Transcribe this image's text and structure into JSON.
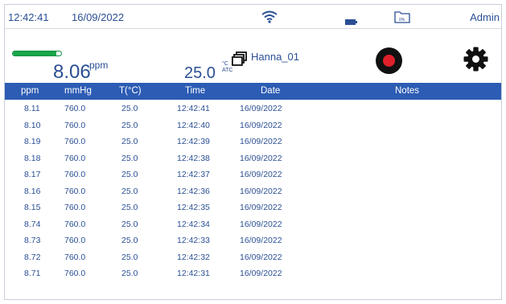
{
  "status_bar": {
    "time": "12:42:41",
    "date": "16/09/2022",
    "user": "Admin",
    "icons": [
      "wifi-icon",
      "battery-icon",
      "folder-icon"
    ],
    "folder_label": "0%"
  },
  "reading": {
    "value": "8.06",
    "unit": "ppm",
    "temperature": "25.0",
    "temp_unit_top": "°C",
    "temp_unit_bottom": "ATC",
    "sensor_name": "Hanna_01",
    "level_fraction": 0.9,
    "level_color": "#19a64a",
    "record_color": "#e0202a"
  },
  "table": {
    "header_color": "#2d5cb4",
    "columns": [
      "ppm",
      "mmHg",
      "T(°C)",
      "Time",
      "Date",
      "Notes"
    ],
    "rows": [
      [
        "8.11",
        "760.0",
        "25.0",
        "12:42:41",
        "16/09/2022"
      ],
      [
        "8.10",
        "760.0",
        "25.0",
        "12:42:40",
        "16/09/2022"
      ],
      [
        "8.19",
        "760.0",
        "25.0",
        "12:42:39",
        "16/09/2022"
      ],
      [
        "8.18",
        "760.0",
        "25.0",
        "12:42:38",
        "16/09/2022"
      ],
      [
        "8.17",
        "760.0",
        "25.0",
        "12:42:37",
        "16/09/2022"
      ],
      [
        "8.16",
        "760.0",
        "25.0",
        "12:42:36",
        "16/09/2022"
      ],
      [
        "8.15",
        "760.0",
        "25.0",
        "12:42:35",
        "16/09/2022"
      ],
      [
        "8.74",
        "760.0",
        "25.0",
        "12:42:34",
        "16/09/2022"
      ],
      [
        "8.73",
        "760.0",
        "25.0",
        "12:42:33",
        "16/09/2022"
      ],
      [
        "8.72",
        "760.0",
        "25.0",
        "12:42:32",
        "16/09/2022"
      ],
      [
        "8.71",
        "760.0",
        "25.0",
        "12:42:31",
        "16/09/2022"
      ]
    ]
  }
}
